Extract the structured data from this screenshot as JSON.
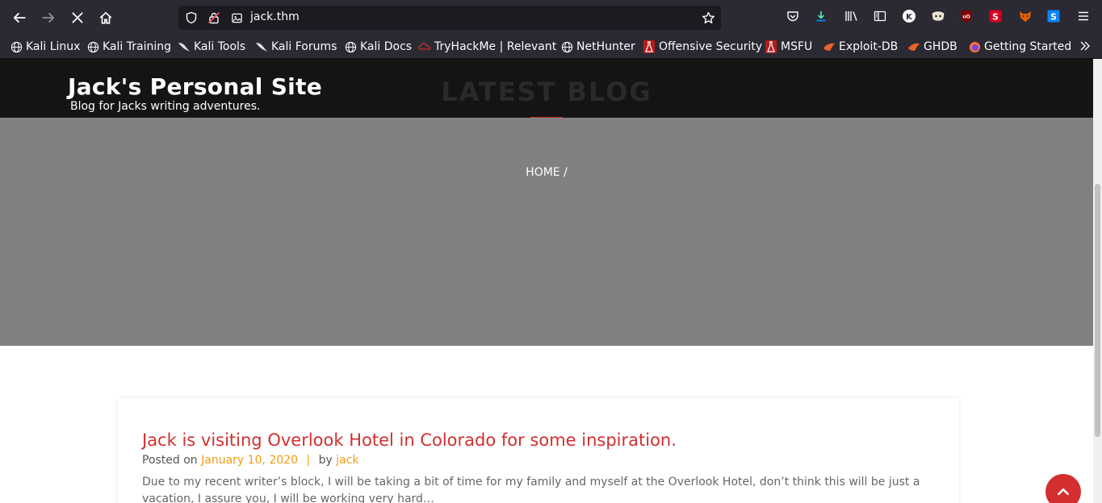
{
  "browser": {
    "url": "jack.thm",
    "bookmarks": [
      {
        "label": "Kali Linux",
        "icon": "globe-icon"
      },
      {
        "label": "Kali Training",
        "icon": "globe-icon"
      },
      {
        "label": "Kali Tools",
        "icon": "kali-dragon-icon"
      },
      {
        "label": "Kali Forums",
        "icon": "kali-dragon-icon"
      },
      {
        "label": "Kali Docs",
        "icon": "globe-icon"
      },
      {
        "label": "TryHackMe | Relevant",
        "icon": "tryhackme-icon"
      },
      {
        "label": "NetHunter",
        "icon": "globe-icon"
      },
      {
        "label": "Offensive Security",
        "icon": "offsec-icon"
      },
      {
        "label": "MSFU",
        "icon": "offsec-icon"
      },
      {
        "label": "Exploit-DB",
        "icon": "exploitdb-icon"
      },
      {
        "label": "GHDB",
        "icon": "exploitdb-icon"
      },
      {
        "label": "Getting Started",
        "icon": "firefox-icon"
      }
    ]
  },
  "site": {
    "title": "Jack's Personal Site",
    "tagline": "Blog for Jacks writing adventures."
  },
  "hero": {
    "title": "LATEST BLOG",
    "breadcrumb": "HOME /"
  },
  "post": {
    "title": "Jack is visiting Overlook Hotel in Colorado for some inspiration.",
    "posted_on_label": "Posted on",
    "date": "January 10, 2020",
    "separator": "|",
    "by_label": "by",
    "author": "jack",
    "excerpt": "Due to my recent writer’s block, I will be taking a bit of time for my family and myself at the Overlook Hotel, don’t think this will be just a vacation, I assure you, I will be working very hard…"
  },
  "colors": {
    "accent": "#d32f2f",
    "link": "#f39c12",
    "hero_bg": "#808080",
    "header_bg": "#141414"
  }
}
